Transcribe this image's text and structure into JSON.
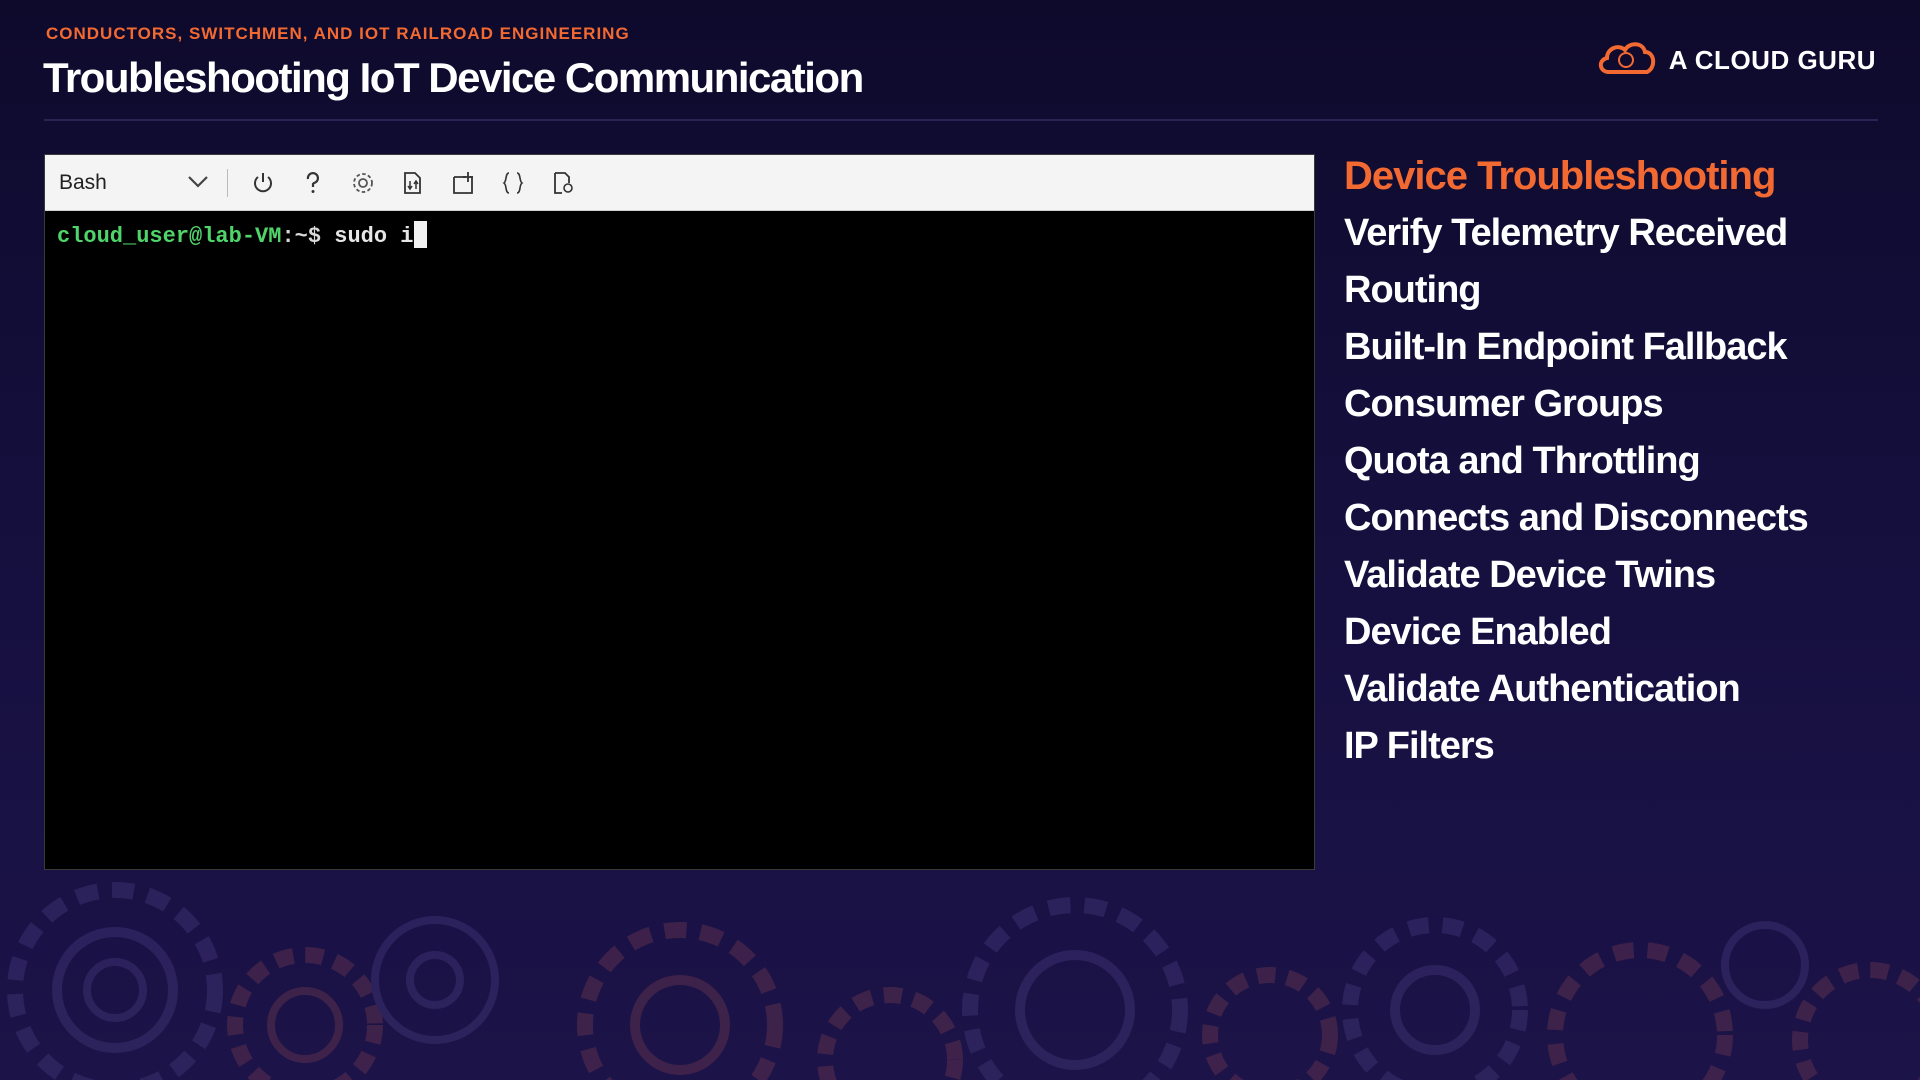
{
  "header": {
    "eyebrow": "CONDUCTORS, SWITCHMEN, AND IOT RAILROAD ENGINEERING",
    "title": "Troubleshooting IoT Device Communication",
    "brand": "A CLOUD GURU"
  },
  "terminal": {
    "shell": "Bash",
    "toolbar_icons": [
      "power-icon",
      "help-icon",
      "settings-icon",
      "upload-download-icon",
      "open-new-session-icon",
      "editor-braces-icon",
      "web-preview-icon"
    ],
    "prompt_user": "cloud_user@lab-VM",
    "prompt_suffix": ":~$",
    "command": "sudo i"
  },
  "topics": [
    "Device Troubleshooting",
    "Verify Telemetry Received",
    "Routing",
    "Built-In Endpoint Fallback",
    "Consumer Groups",
    "Quota and Throttling",
    "Connects and Disconnects",
    "Validate Device Twins",
    "Device Enabled",
    "Validate Authentication",
    "IP Filters"
  ],
  "colors": {
    "accent": "#f26a32",
    "background": "#160f3e",
    "prompt": "#4fd46a"
  }
}
